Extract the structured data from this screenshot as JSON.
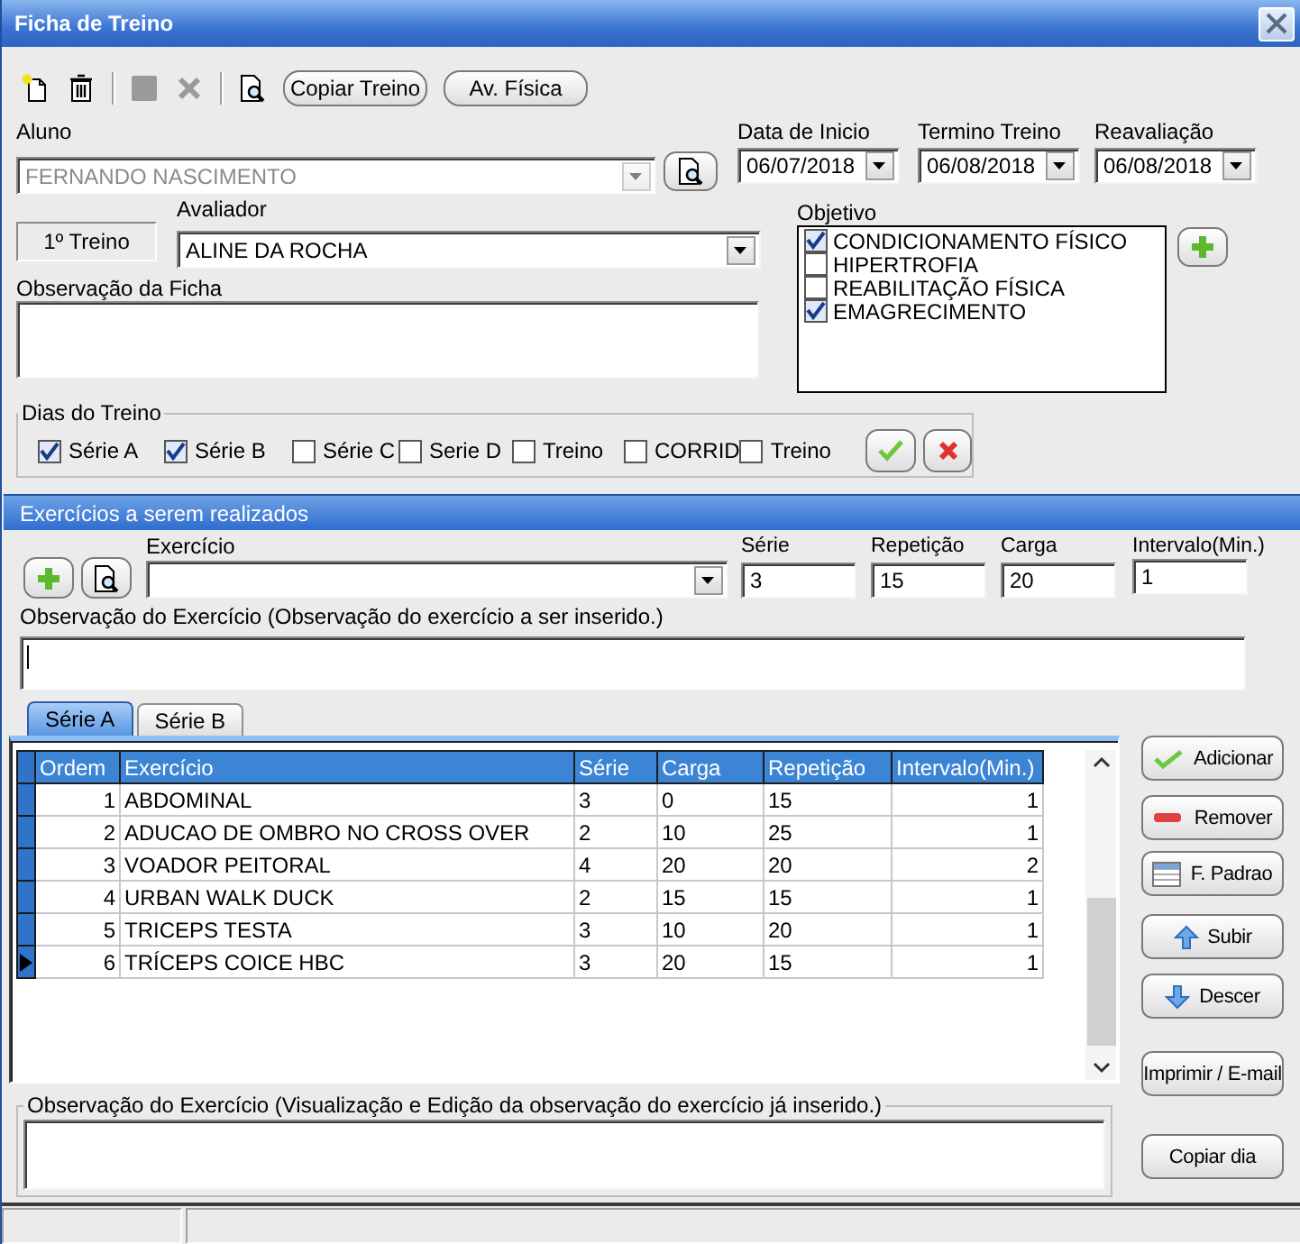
{
  "window": {
    "title": "Ficha de Treino"
  },
  "toolbar": {
    "icons": [
      {
        "kind": "new",
        "disabled": false
      },
      {
        "kind": "delete",
        "disabled": false
      },
      {
        "kind": "save",
        "disabled": true
      },
      {
        "kind": "cancel",
        "disabled": true
      },
      {
        "kind": "preview",
        "disabled": false
      }
    ],
    "buttons": [
      "Copiar Treino",
      "Av. Física"
    ]
  },
  "aluno": {
    "label": "Aluno",
    "value": "FERNANDO NASCIMENTO",
    "disabled": true
  },
  "dates": [
    {
      "label": "Data de Inicio",
      "value": "06/07/2018"
    },
    {
      "label": "Termino Treino",
      "value": "06/08/2018"
    },
    {
      "label": "Reavaliação",
      "value": "06/08/2018"
    }
  ],
  "treino_badge": "1º Treino",
  "avaliador": {
    "label": "Avaliador",
    "value": "ALINE DA ROCHA"
  },
  "objetivo": {
    "label": "Objetivo",
    "items": [
      {
        "label": "CONDICIONAMENTO FÍSICO",
        "checked": true
      },
      {
        "label": "HIPERTROFIA",
        "checked": false
      },
      {
        "label": "REABILITAÇÃO FÍSICA",
        "checked": false
      },
      {
        "label": "EMAGRECIMENTO",
        "checked": true
      }
    ]
  },
  "observacao_ficha": {
    "label": "Observação da Ficha"
  },
  "dias_do_treino": {
    "label": "Dias do Treino",
    "days": [
      {
        "label": "Série A",
        "checked": true
      },
      {
        "label": "Série B",
        "checked": true
      },
      {
        "label": "Série C",
        "checked": false
      },
      {
        "label": "Serie D",
        "checked": false
      },
      {
        "label": "Treino",
        "checked": false
      },
      {
        "label": "CORRID",
        "checked": false
      },
      {
        "label": "Treino",
        "checked": false
      }
    ]
  },
  "exercicios": {
    "title": "Exercícios a serem realizados",
    "exercicio": {
      "label": "Exercício"
    },
    "fields": [
      {
        "label": "Série",
        "value": "3"
      },
      {
        "label": "Repetição",
        "value": "15"
      },
      {
        "label": "Carga",
        "value": "20"
      },
      {
        "label": "Intervalo(Min.)",
        "value": "1"
      }
    ],
    "observacao": {
      "label": "Observação do Exercício (Observação do exercício a ser inserido.)"
    },
    "tabs": [
      {
        "label": "Série A",
        "selected": true
      },
      {
        "label": "Série B",
        "selected": false
      }
    ]
  },
  "table": {
    "columns": [
      "Ordem",
      "Exercício",
      "Série",
      "Carga",
      "Repetição",
      "Intervalo(Min.)"
    ],
    "rows": [
      {
        "cells": [
          "1",
          "ABDOMINAL",
          "3",
          "0",
          "15",
          "1"
        ],
        "current": false
      },
      {
        "cells": [
          "2",
          "ADUCAO DE OMBRO NO CROSS OVER",
          "2",
          "10",
          "25",
          "1"
        ],
        "current": false
      },
      {
        "cells": [
          "3",
          "VOADOR PEITORAL",
          "4",
          "20",
          "20",
          "2"
        ],
        "current": false
      },
      {
        "cells": [
          "4",
          "URBAN WALK DUCK",
          "2",
          "15",
          "15",
          "1"
        ],
        "current": false
      },
      {
        "cells": [
          "5",
          "TRICEPS TESTA",
          "3",
          "10",
          "20",
          "1"
        ],
        "current": false
      },
      {
        "cells": [
          "6",
          "TRÍCEPS COICE HBC",
          "3",
          "20",
          "15",
          "1"
        ],
        "current": true
      }
    ]
  },
  "side_buttons": [
    {
      "kind": "add",
      "label": "Adicionar"
    },
    {
      "kind": "remove",
      "label": "Remover"
    },
    {
      "kind": "grid",
      "label": "F. Padrao"
    },
    {
      "kind": "up",
      "label": "Subir"
    },
    {
      "kind": "down",
      "label": "Descer"
    },
    {
      "kind": "plain",
      "label": "Imprimir / E-mail"
    },
    {
      "kind": "plain",
      "label": "Copiar dia"
    }
  ],
  "observacao_view": {
    "label": "Observação do Exercício (Visualização e Edição da observação do exercício já inserido.)"
  }
}
